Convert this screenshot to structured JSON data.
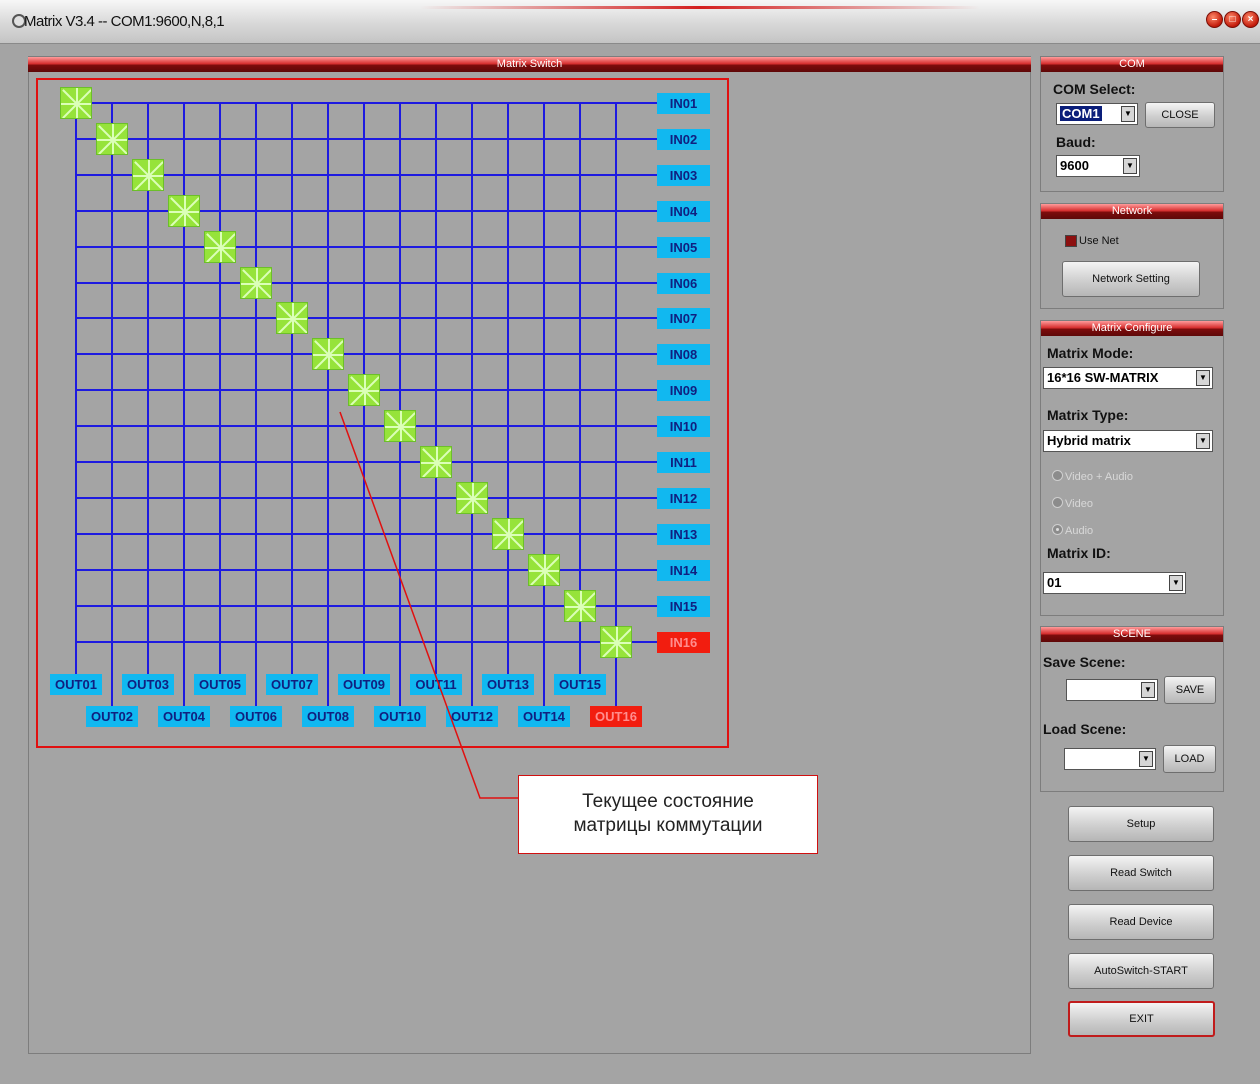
{
  "window": {
    "title": "Matrix V3.4 -- COM1:9600,N,8,1",
    "controls": [
      "min",
      "max",
      "close"
    ]
  },
  "matrix_panel": {
    "header": "Matrix Switch",
    "inputs": [
      "IN01",
      "IN02",
      "IN03",
      "IN04",
      "IN05",
      "IN06",
      "IN07",
      "IN08",
      "IN09",
      "IN10",
      "IN11",
      "IN12",
      "IN13",
      "IN14",
      "IN15",
      "IN16"
    ],
    "outputs": [
      "OUT01",
      "OUT02",
      "OUT03",
      "OUT04",
      "OUT05",
      "OUT06",
      "OUT07",
      "OUT08",
      "OUT09",
      "OUT10",
      "OUT11",
      "OUT12",
      "OUT13",
      "OUT14",
      "OUT15",
      "OUT16"
    ],
    "active_input": "IN16",
    "active_output": "OUT16",
    "connections": "diagonal (IN n -> OUT n)",
    "colors": {
      "grid": "#1d1ae0",
      "label": "#11b8f0",
      "active": "#f21d0f",
      "node": "#96e33a",
      "frame": "#e01010"
    }
  },
  "callout": {
    "line1": "Текущее состояние",
    "line2": "матрицы коммутации"
  },
  "com": {
    "header": "COM",
    "com_select_label": "COM Select:",
    "com_value": "COM1",
    "close_button": "CLOSE",
    "baud_label": "Baud:",
    "baud_value": "9600"
  },
  "network": {
    "header": "Network",
    "use_net_label": "Use Net",
    "setting_button": "Network Setting"
  },
  "matrix_config": {
    "header": "Matrix Configure",
    "mode_label": "Matrix Mode:",
    "mode_value": "16*16 SW-MATRIX",
    "type_label": "Matrix Type:",
    "type_value": "Hybrid matrix",
    "radio_video_audio": "Video + Audio",
    "radio_video": "Video",
    "radio_audio": "Audio",
    "id_label": "Matrix ID:",
    "id_value": "01"
  },
  "scene": {
    "header": "SCENE",
    "save_label": "Save Scene:",
    "save_button": "SAVE",
    "load_label": "Load Scene:",
    "load_button": "LOAD"
  },
  "actions": {
    "setup": "Setup",
    "read_switch": "Read Switch",
    "read_device": "Read Device",
    "autoswitch": "AutoSwitch-START",
    "exit": "EXIT"
  }
}
